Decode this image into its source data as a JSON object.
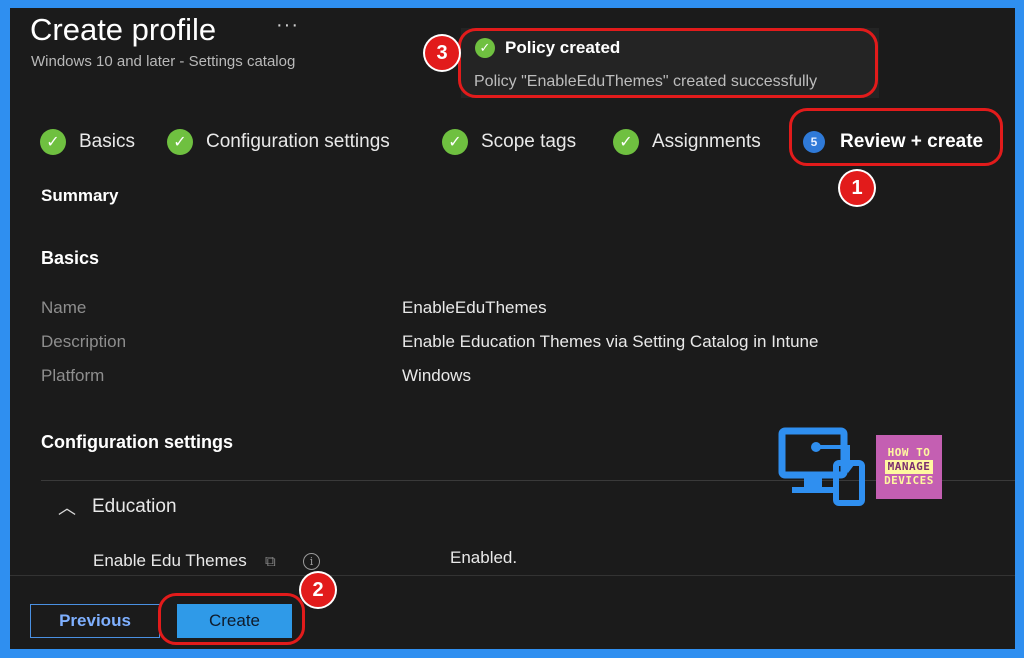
{
  "header": {
    "title": "Create profile",
    "more_label": "···",
    "subtitle": "Windows 10 and later - Settings catalog"
  },
  "toast": {
    "title": "Policy created",
    "message": "Policy \"EnableEduThemes\" created successfully",
    "status_color": "#6fc040"
  },
  "tabs": [
    {
      "label": "Basics",
      "state": "done"
    },
    {
      "label": "Configuration settings",
      "state": "done"
    },
    {
      "label": "Scope tags",
      "state": "done"
    },
    {
      "label": "Assignments",
      "state": "done"
    },
    {
      "label": "Review + create",
      "state": "active",
      "step": "5"
    }
  ],
  "summary": {
    "heading": "Summary",
    "basics_heading": "Basics",
    "fields": [
      {
        "label": "Name",
        "value": "EnableEduThemes"
      },
      {
        "label": "Description",
        "value": "Enable Education Themes via Setting Catalog in Intune"
      },
      {
        "label": "Platform",
        "value": "Windows"
      }
    ],
    "config_heading": "Configuration settings",
    "group": {
      "label": "Education"
    },
    "setting": {
      "label": "Enable Edu Themes",
      "value": "Enabled."
    }
  },
  "footer": {
    "previous_label": "Previous",
    "create_label": "Create"
  },
  "annotations": {
    "badge1": "1",
    "badge2": "2",
    "badge3": "3",
    "color": "#e21b1b"
  },
  "logo": {
    "line1": "HOW TO",
    "line2": "MANAGE",
    "line3": "DEVICES"
  },
  "colors": {
    "accent": "#2f9ae8",
    "border": "#2f8ff0",
    "background": "#1b1b1b"
  }
}
